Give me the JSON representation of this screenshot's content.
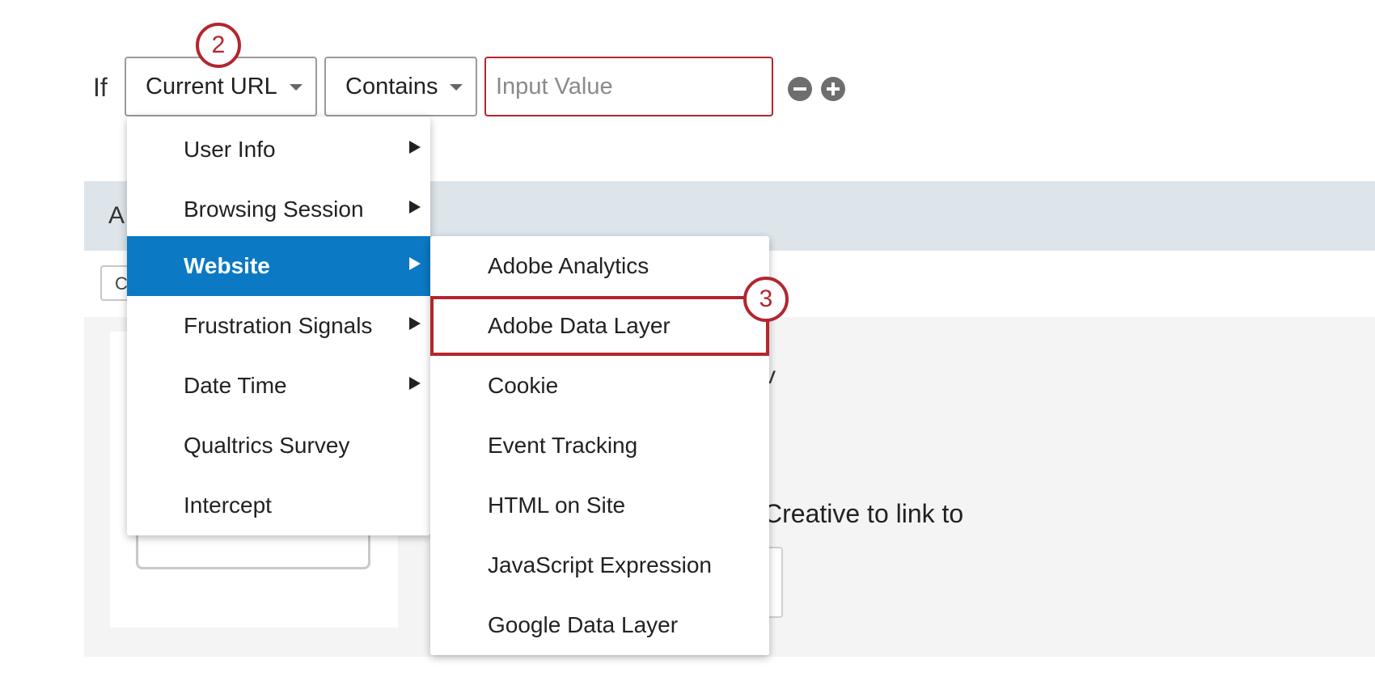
{
  "condition": {
    "if_label": "If",
    "field_select": "Current URL",
    "operator_select": "Contains",
    "value_placeholder": "Input Value"
  },
  "callouts": {
    "step2": "2",
    "step3": "3"
  },
  "background": {
    "band_text": "A",
    "small_box_text": "C",
    "panel_fragment": "v",
    "creative_text": "Creative to link to"
  },
  "main_menu": {
    "items": [
      {
        "label": "User Info",
        "has_submenu": true
      },
      {
        "label": "Browsing Session",
        "has_submenu": true
      },
      {
        "label": "Website",
        "has_submenu": true,
        "active": true
      },
      {
        "label": "Frustration Signals",
        "has_submenu": true
      },
      {
        "label": "Date Time",
        "has_submenu": true
      },
      {
        "label": "Qualtrics Survey",
        "has_submenu": false
      },
      {
        "label": "Intercept",
        "has_submenu": false
      }
    ]
  },
  "website_submenu": {
    "items": [
      {
        "label": "Adobe Analytics"
      },
      {
        "label": "Adobe Data Layer",
        "highlighted": true
      },
      {
        "label": "Cookie"
      },
      {
        "label": "Event Tracking"
      },
      {
        "label": "HTML on Site"
      },
      {
        "label": "JavaScript Expression"
      },
      {
        "label": "Google Data Layer"
      }
    ]
  },
  "colors": {
    "callout_red": "#b3262e",
    "active_blue": "#0b79c3",
    "band_gray": "#dde5ea",
    "panel_gray": "#f4f4f4"
  }
}
